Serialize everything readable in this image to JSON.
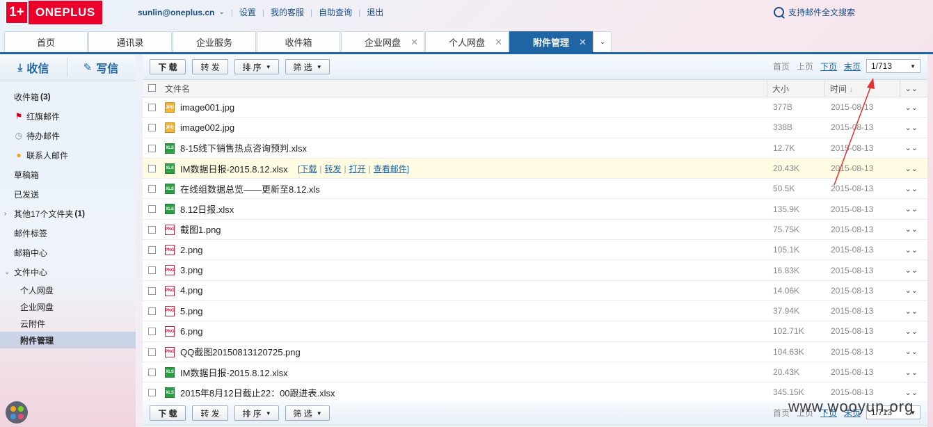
{
  "brand": {
    "mark": "1+",
    "name": "ONEPLUS",
    "color": "#eb0029"
  },
  "userbar": {
    "email": "sunlin@oneplus.cn",
    "links": [
      "设置",
      "我的客服",
      "自助查询",
      "退出"
    ]
  },
  "search": {
    "label": "支持邮件全文搜索"
  },
  "tabs": [
    {
      "label": "首页",
      "closable": false,
      "active": false
    },
    {
      "label": "通讯录",
      "closable": false,
      "active": false
    },
    {
      "label": "企业服务",
      "closable": false,
      "active": false
    },
    {
      "label": "收件箱",
      "closable": false,
      "active": false
    },
    {
      "label": "企业网盘",
      "closable": true,
      "active": false
    },
    {
      "label": "个人网盘",
      "closable": true,
      "active": false
    },
    {
      "label": "附件管理",
      "closable": true,
      "active": true
    }
  ],
  "sidebar": {
    "receive": "收信",
    "compose": "写信",
    "folders": {
      "inbox": {
        "label": "收件箱",
        "count": "(3)"
      },
      "flagged": "红旗邮件",
      "todo": "待办邮件",
      "contacts": "联系人邮件",
      "drafts": "草稿箱",
      "sent": "已发送",
      "others": {
        "label": "其他17个文件夹",
        "count": "(1)"
      },
      "tags": "邮件标签",
      "center": "邮箱中心",
      "files": "文件中心",
      "files_sub": [
        "个人网盘",
        "企业网盘",
        "云附件",
        "附件管理"
      ]
    }
  },
  "toolbar": {
    "download": "下 载",
    "forward": "转 发",
    "sort": "排 序",
    "filter": "筛 选",
    "pager": {
      "first": "首页",
      "prev": "上页",
      "next": "下页",
      "last": "末页",
      "page": "1/713"
    }
  },
  "table": {
    "headers": {
      "name": "文件名",
      "size": "大小",
      "time": "时间"
    },
    "row_actions": [
      "下载",
      "转发",
      "打开",
      "查看邮件"
    ],
    "rows": [
      {
        "type": "jpg",
        "name": "image001.jpg",
        "size": "377B",
        "time": "2015-08-13"
      },
      {
        "type": "jpg",
        "name": "image002.jpg",
        "size": "338B",
        "time": "2015-08-13"
      },
      {
        "type": "xls",
        "name": "8-15线下销售热点咨询预判.xlsx",
        "size": "12.7K",
        "time": "2015-08-13"
      },
      {
        "type": "xls",
        "name": "IM数据日报-2015.8.12.xlsx",
        "size": "20.43K",
        "time": "2015-08-13",
        "highlight": true
      },
      {
        "type": "xls",
        "name": "在线组数据总览——更新至8.12.xls",
        "size": "50.5K",
        "time": "2015-08-13"
      },
      {
        "type": "xls",
        "name": "8.12日报.xlsx",
        "size": "135.9K",
        "time": "2015-08-13"
      },
      {
        "type": "png",
        "name": "截图1.png",
        "size": "75.75K",
        "time": "2015-08-13"
      },
      {
        "type": "png",
        "name": "2.png",
        "size": "105.1K",
        "time": "2015-08-13"
      },
      {
        "type": "png",
        "name": "3.png",
        "size": "16.83K",
        "time": "2015-08-13"
      },
      {
        "type": "png",
        "name": "4.png",
        "size": "14.06K",
        "time": "2015-08-13"
      },
      {
        "type": "png",
        "name": "5.png",
        "size": "37.94K",
        "time": "2015-08-13"
      },
      {
        "type": "png",
        "name": "6.png",
        "size": "102.71K",
        "time": "2015-08-13"
      },
      {
        "type": "png",
        "name": "QQ截图20150813120725.png",
        "size": "104.63K",
        "time": "2015-08-13"
      },
      {
        "type": "xls",
        "name": "IM数据日报-2015.8.12.xlsx",
        "size": "20.43K",
        "time": "2015-08-13"
      },
      {
        "type": "xls",
        "name": "2015年8月12日截止22：00跟进表.xlsx",
        "size": "345.15K",
        "time": "2015-08-13"
      }
    ]
  },
  "watermark": "www.wooyun.org",
  "colors": {
    "primary": "#1f65a4",
    "highlight_row": "#fffbe2",
    "annotation": "#e03030"
  }
}
